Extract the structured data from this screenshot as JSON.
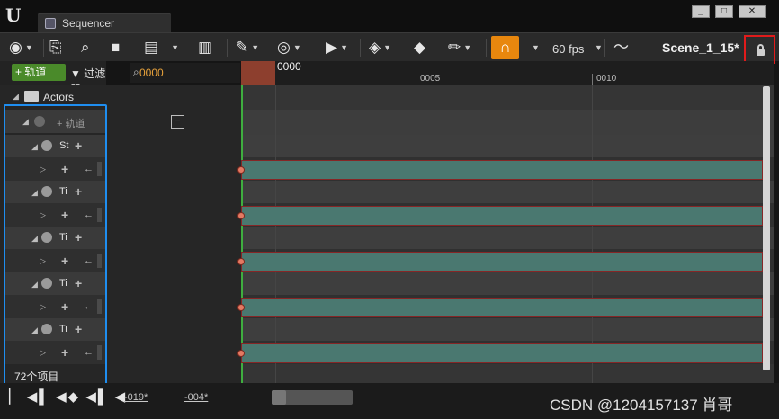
{
  "window": {
    "tab_title": "Sequencer",
    "controls": {
      "minimize": "_",
      "maximize": "□",
      "close": "✕"
    }
  },
  "toolbar": {
    "fps_label": "60 fps",
    "scene_name": "Scene_1_15*"
  },
  "left_panel": {
    "add_track_label": "+ 轨道",
    "filter_label": "▼ 过滤器 ▾",
    "search_value": "0000",
    "actors_label": "Actors",
    "group_track_label": "+ 轨道",
    "items_count": "72个项目",
    "rows": [
      {
        "kind": "actor",
        "label": "St"
      },
      {
        "kind": "actor",
        "label": "Ti"
      },
      {
        "kind": "actor",
        "label": "Ti"
      },
      {
        "kind": "actor",
        "label": "Ti"
      },
      {
        "kind": "actor",
        "label": "Ti"
      }
    ]
  },
  "timeline": {
    "playhead_label": "0000",
    "ticks": [
      "0005",
      "0010"
    ]
  },
  "bottom": {
    "range_start": "-019*",
    "range_end": "-004*"
  },
  "watermark": "CSDN @1204157137 肖哥",
  "colors": {
    "accent_orange": "#e8870e",
    "section_green": "#4a7870",
    "selection_blue": "#1f8ef0",
    "lock_highlight": "#e11b1b",
    "playhead": "#8d3f2e"
  }
}
